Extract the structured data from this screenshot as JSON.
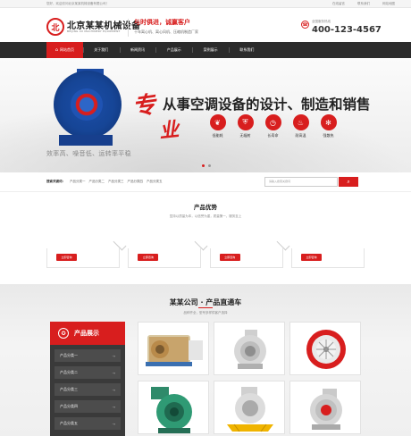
{
  "topbar": {
    "welcome": "您好，欢迎访问北京某某机械设备有限公司！",
    "links": [
      "在线留言",
      "联系我们",
      "网站地图"
    ]
  },
  "header": {
    "logo_mark": "北",
    "company": "北京某某机械设备",
    "company_en": "BEIJING XX MACHINERY EQUIPMENT",
    "slogan_main": "与时俱进，诚赢客户",
    "slogan_sub": "十年离心机、离心风机、压缩机制造厂家",
    "hotline_label": "全国服务热线",
    "hotline": "400-123-4567"
  },
  "nav": {
    "items": [
      "网站首页",
      "关于我们",
      "新闻资讯",
      "产品展示",
      "案例展示",
      "联系我们"
    ]
  },
  "banner": {
    "zhuan": "专",
    "ye": "业",
    "headline": "从事空调设备的设计、制造和销售",
    "features": [
      {
        "label": "低能耗",
        "icon": "leaf-icon"
      },
      {
        "label": "无辐射",
        "icon": "shield-icon"
      },
      {
        "label": "长寿命",
        "icon": "clock-icon"
      },
      {
        "label": "耐高温",
        "icon": "flame-icon"
      },
      {
        "label": "强散热",
        "icon": "fan-icon"
      }
    ],
    "tagline": "效率高、噪音低、运转率平稳",
    "active_slide": 1
  },
  "search": {
    "label": "搜索关键词：",
    "keywords": [
      "产品分类一",
      "产品分类二",
      "产品分类三",
      "产品分类四",
      "产品分类五"
    ],
    "placeholder": "请输入搜索关键词"
  },
  "advantage": {
    "title": "产品优势",
    "desc": "坚持以质量为本，以信誉为重，质量第一，服务至上",
    "button": "立即咨询"
  },
  "products": {
    "title": "某某公司 · 产品直通车",
    "desc": "品种齐全，型号多样供客户选择",
    "sidebar_title": "产品展示",
    "categories": [
      "产品分类一",
      "产品分类二",
      "产品分类三",
      "产品分类四",
      "产品分类五"
    ]
  },
  "colors": {
    "accent": "#d81e1e",
    "nav_bg": "#2b2b2b",
    "sidebar_bg": "#3a3a3a"
  }
}
